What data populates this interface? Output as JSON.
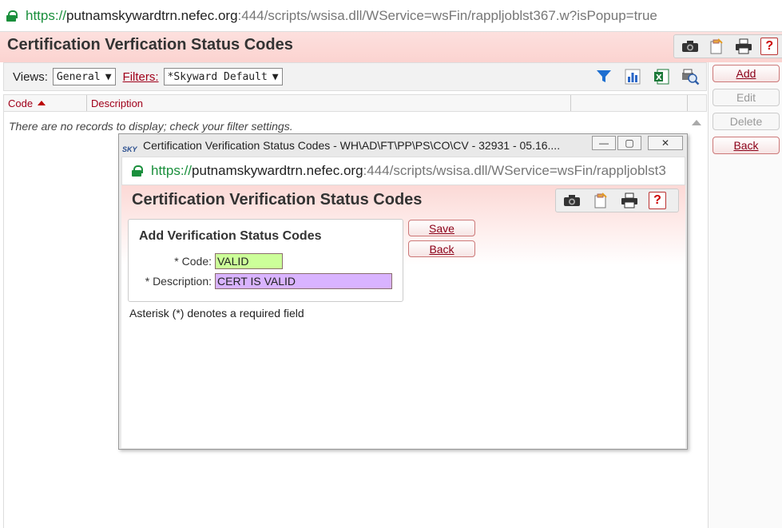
{
  "browser": {
    "url_scheme": "https://",
    "url_host": "putnamskywardtrn.nefec.org",
    "url_path": ":444/scripts/wsisa.dll/WService=wsFin/rappljoblst367.w?isPopup=true"
  },
  "page": {
    "title": "Certification Verfication Status Codes"
  },
  "toolbar": {
    "icons": [
      "camera-icon",
      "clipboard-icon",
      "printer-icon",
      "help-icon"
    ],
    "help_label": "?"
  },
  "views_bar": {
    "views_label": "Views:",
    "views_value": "General",
    "filters_label": "Filters:",
    "filters_value": "*Skyward Default",
    "icons": [
      "filter-icon",
      "chart-icon",
      "excel-icon",
      "print-preview-icon"
    ]
  },
  "right_buttons": {
    "add": "Add",
    "edit": "Edit",
    "delete": "Delete",
    "back": "Back"
  },
  "grid": {
    "columns": [
      "Code",
      "Description"
    ],
    "empty_message": "There are no records to display; check your filter settings."
  },
  "popup": {
    "window_title": "Certification Verification Status Codes - WH\\AD\\FT\\PP\\PS\\CO\\CV - 32931 - 05.16....",
    "url_scheme": "https://",
    "url_host": "putnamskywardtrn.nefec.org",
    "url_path": ":444/scripts/wsisa.dll/WService=wsFin/rappljoblst3",
    "title": "Certification Verification Status Codes",
    "help_label": "?",
    "form": {
      "heading": "Add Verification Status Codes",
      "code_label": "* Code:",
      "code_value": "VALID",
      "description_label": "* Description:",
      "description_value": "CERT IS VALID",
      "save_label": "Save",
      "back_label": "Back",
      "note": "Asterisk (*) denotes a required field"
    },
    "colors": {
      "code_bg": "#ccff99",
      "description_bg": "#d9b3ff"
    }
  }
}
